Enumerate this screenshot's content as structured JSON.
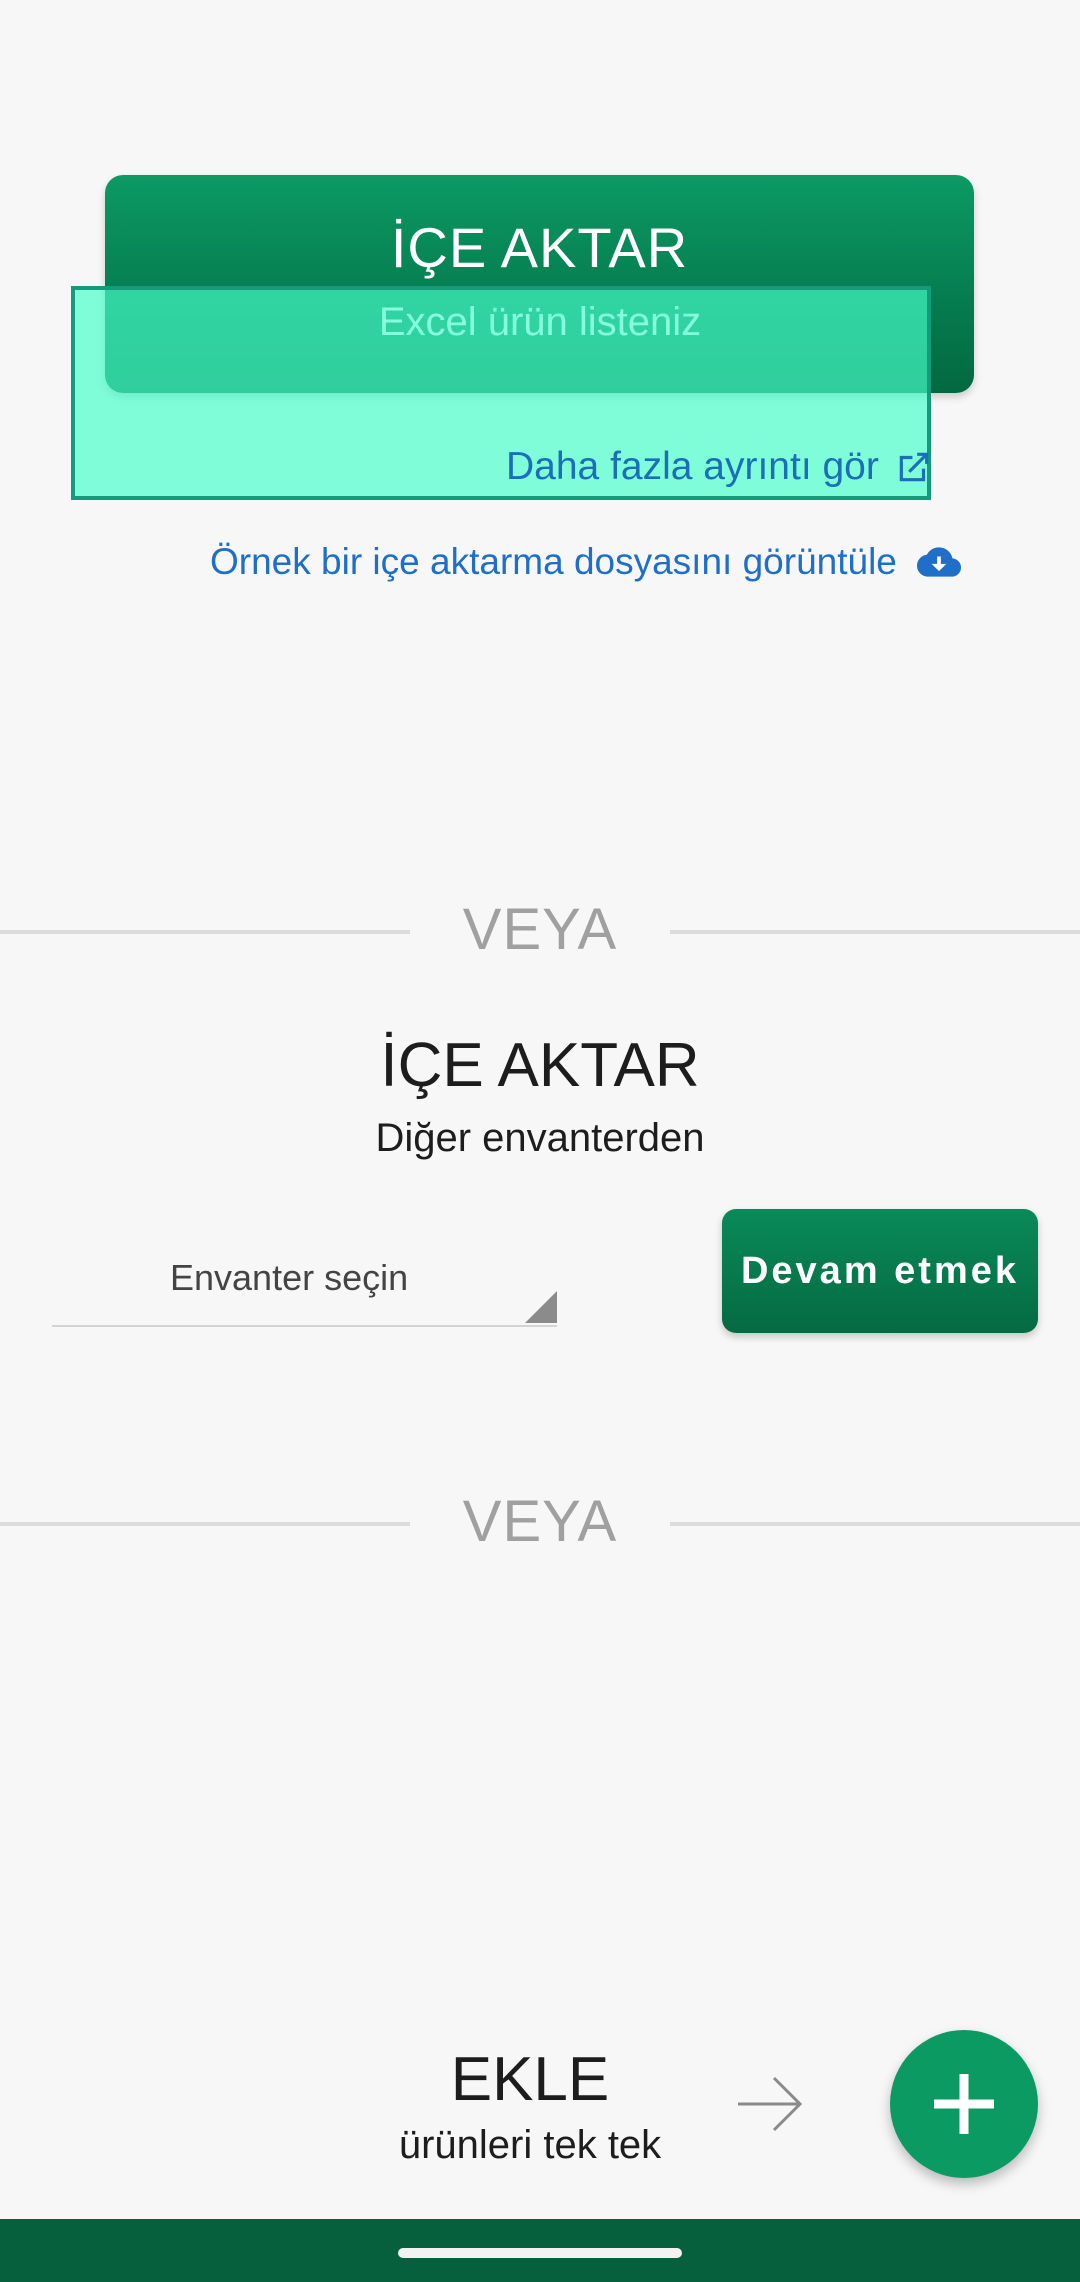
{
  "import_excel": {
    "title": "İÇE AKTAR",
    "subtitle": "Excel ürün listeniz",
    "details_link": "Daha fazla ayrıntı gör",
    "details_icon": "external-link-icon",
    "sample_link": "Örnek bir içe aktarma dosyasını görüntüle",
    "sample_icon": "cloud-download-icon"
  },
  "divider_1": {
    "label": "VEYA"
  },
  "import_inventory": {
    "title": "İÇE AKTAR",
    "subtitle": "Diğer envanterden",
    "select_placeholder": "Envanter seçin",
    "continue_label": "Devam etmek"
  },
  "divider_2": {
    "label": "VEYA"
  },
  "add_section": {
    "title": "EKLE",
    "subtitle": "ürünleri tek tek",
    "arrow_icon": "arrow-right-icon",
    "fab_icon": "plus-icon"
  },
  "colors": {
    "primary_green": "#0c9a63",
    "dark_green": "#06603e",
    "link_blue": "#1f6ec8",
    "highlight": "#46ffc8"
  }
}
